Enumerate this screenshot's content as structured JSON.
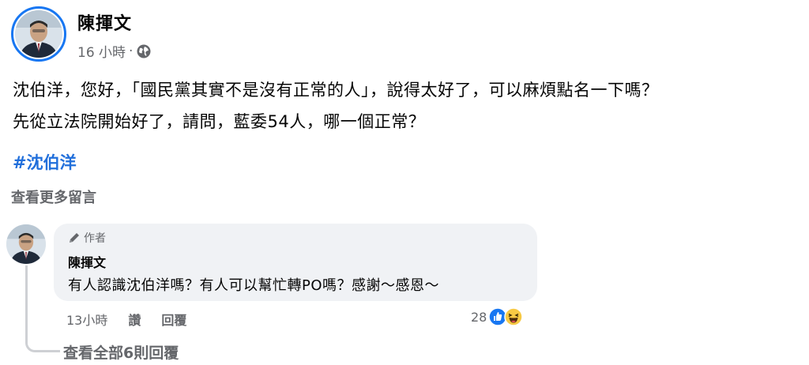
{
  "post": {
    "author": "陳揮文",
    "time": "16 小時",
    "separator": "·",
    "privacy_icon": "globe-icon",
    "text_line1": "沈伯洋，您好，「國民黨其實不是沒有正常的人」，說得太好了，可以麻煩點名一下嗎？",
    "text_line2": "先從立法院開始好了，請問，藍委54人，哪一個正常？",
    "hashtag": "#沈伯洋"
  },
  "comments": {
    "view_more": "查看更多留言",
    "items": [
      {
        "badge": "作者",
        "badge_icon": "pencil-icon",
        "author": "陳揮文",
        "text": "有人認識沈伯洋嗎？有人可以幫忙轉PO嗎？感謝～感恩～",
        "time": "13小時",
        "like_label": "讚",
        "reply_label": "回覆",
        "reaction_count": "28",
        "reaction_icons": [
          "like-reaction-icon",
          "haha-reaction-icon"
        ]
      }
    ],
    "view_replies": "查看全部6則回覆"
  },
  "colors": {
    "accent": "#1877f2",
    "hashtag": "#216fdb",
    "muted_text": "#65676b",
    "bubble": "#f0f2f5"
  }
}
